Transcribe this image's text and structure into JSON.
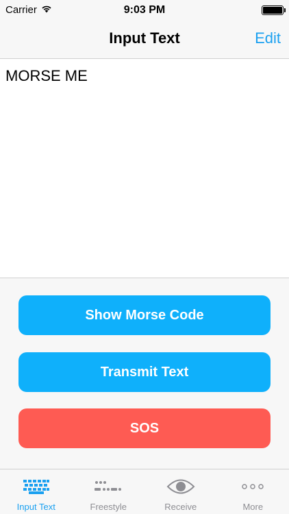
{
  "status_bar": {
    "carrier": "Carrier",
    "time": "9:03 PM"
  },
  "nav": {
    "title": "Input Text",
    "edit_label": "Edit"
  },
  "input_text": {
    "value": "MORSE ME"
  },
  "actions": {
    "show_morse_label": "Show Morse Code",
    "transmit_label": "Transmit Text",
    "sos_label": "SOS"
  },
  "tabs": [
    {
      "label": "Input Text",
      "icon": "keyboard-icon",
      "active": true
    },
    {
      "label": "Freestyle",
      "icon": "morse-dots-icon",
      "active": false
    },
    {
      "label": "Receive",
      "icon": "eye-icon",
      "active": false
    },
    {
      "label": "More",
      "icon": "ellipsis-icon",
      "active": false
    }
  ],
  "colors": {
    "accent": "#1aa0f0",
    "button_blue": "#0fb0fb",
    "button_red": "#fe5b53",
    "tab_inactive": "#8e8e93"
  }
}
